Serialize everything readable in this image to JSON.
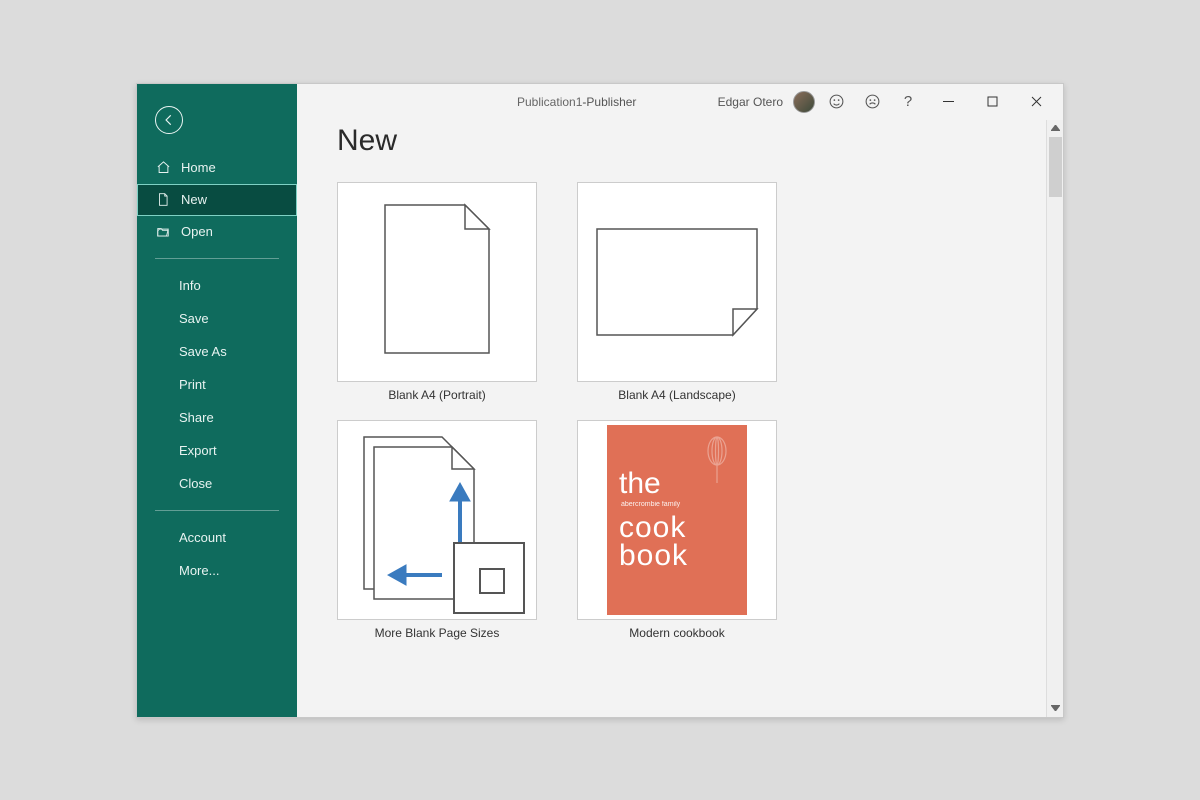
{
  "titlebar": {
    "document": "Publication1",
    "separator": "  -  ",
    "app": "Publisher",
    "user": "Edgar Otero"
  },
  "sidebar": {
    "primary": [
      {
        "label": "Home",
        "icon": "home-icon"
      },
      {
        "label": "New",
        "icon": "page-icon",
        "selected": true
      },
      {
        "label": "Open",
        "icon": "folder-icon"
      }
    ],
    "secondary": [
      "Info",
      "Save",
      "Save As",
      "Print",
      "Share",
      "Export",
      "Close"
    ],
    "tertiary": [
      "Account",
      "More..."
    ]
  },
  "page": {
    "heading": "New",
    "templates": [
      {
        "label": "Blank A4 (Portrait)"
      },
      {
        "label": "Blank A4 (Landscape)"
      },
      {
        "label": "More Blank Page Sizes"
      },
      {
        "label": "Modern cookbook"
      }
    ],
    "cookbook": {
      "line1": "the",
      "subtitle": "abercrombie family",
      "line2a": "cook",
      "line2b": "book"
    }
  }
}
